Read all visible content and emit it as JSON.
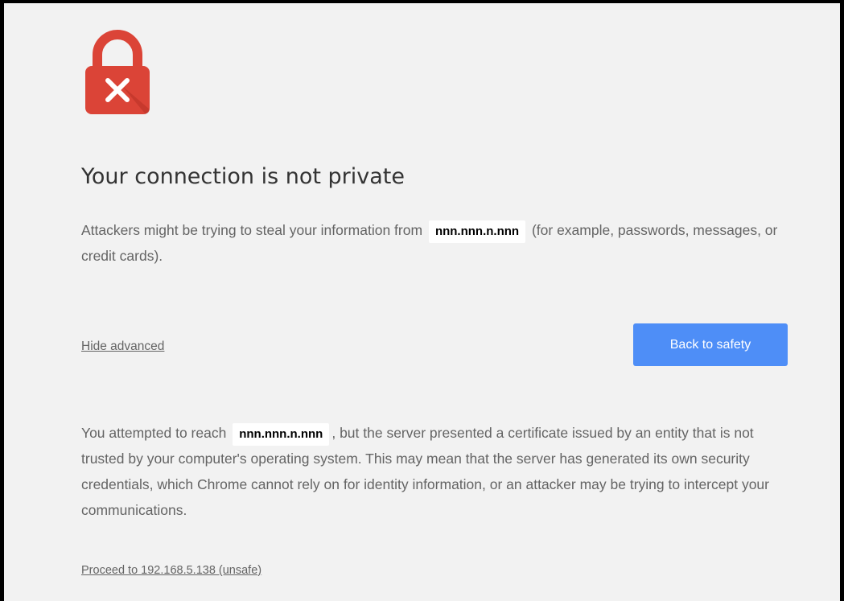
{
  "colors": {
    "page_background": "#f2f2f2",
    "lock_red": "#db4437",
    "button_blue": "#4e8ef7",
    "title_text": "#333333",
    "body_text": "#646464"
  },
  "icon": {
    "name": "lock-error-icon"
  },
  "title": "Your connection is not private",
  "summary": {
    "before": "Attackers might be trying to steal your information from",
    "host": "nnn.nnn.n.nnn",
    "after": "(for example, passwords, messages, or credit cards)."
  },
  "hide_advanced_label": "Hide advanced",
  "back_button_label": "Back to safety",
  "details": {
    "before": "You attempted to reach",
    "host": "nnn.nnn.n.nnn",
    "after": ", but the server presented a certificate issued by an entity that is not trusted by your computer's operating system. This may mean that the server has generated its own security credentials, which Chrome cannot rely on for identity information, or an attacker may be trying to intercept your communications."
  },
  "proceed_link_label": "Proceed to 192.168.5.138 (unsafe)"
}
